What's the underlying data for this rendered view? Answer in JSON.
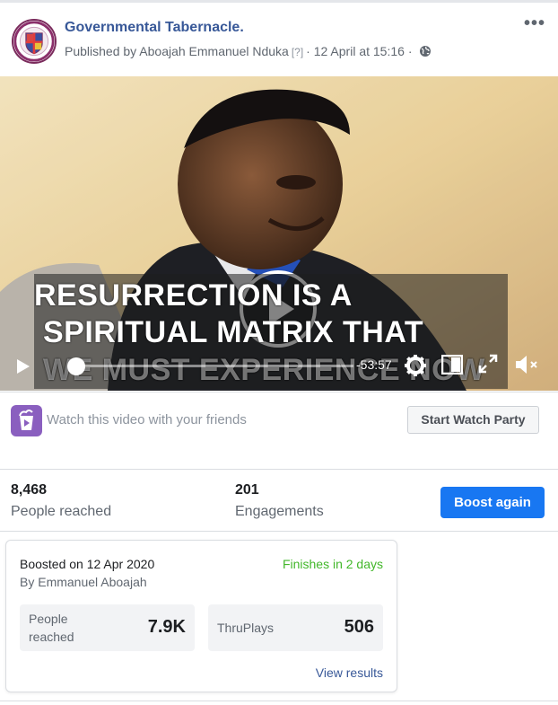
{
  "post": {
    "page_name": "Governmental Tabernacle.",
    "published_by": "Published by Aboajah Emmanuel Nduka",
    "help_marker": "[?]",
    "separator": "·",
    "date": "12 April at 15:16",
    "privacy_icon": "globe-icon",
    "more_icon": "more-options-icon"
  },
  "video": {
    "caption_lines": [
      "RESURRECTION IS A",
      "SPIRITUAL MATRIX THAT",
      "WE MUST EXPERIENCE NOW"
    ],
    "remaining_time": "-53:57",
    "progress": 0.0,
    "icons": [
      "play-icon",
      "settings-icon",
      "picture-in-picture-icon",
      "fullscreen-icon",
      "mute-icon"
    ]
  },
  "watch_party": {
    "prompt": "Watch this video with your friends",
    "button": "Start Watch Party",
    "icon": "watch-party-icon",
    "accent": "#8a5fbf"
  },
  "insights": {
    "people_reached": {
      "value": "8,468",
      "label": "People reached"
    },
    "engagements": {
      "value": "201",
      "label": "Engagements"
    },
    "boost_button": "Boost again",
    "accent": "#1877f2"
  },
  "boost_card": {
    "boosted_on": "Boosted on 12 Apr 2020",
    "boosted_by": "By Emmanuel Aboajah",
    "status": "Finishes in 2 days",
    "status_color": "#42b72a",
    "metrics": [
      {
        "label_line1": "People",
        "label_line2": "reached",
        "value": "7.9K"
      },
      {
        "label_line1": "ThruPlays",
        "label_line2": "",
        "value": "506"
      }
    ],
    "view_results": "View results"
  }
}
